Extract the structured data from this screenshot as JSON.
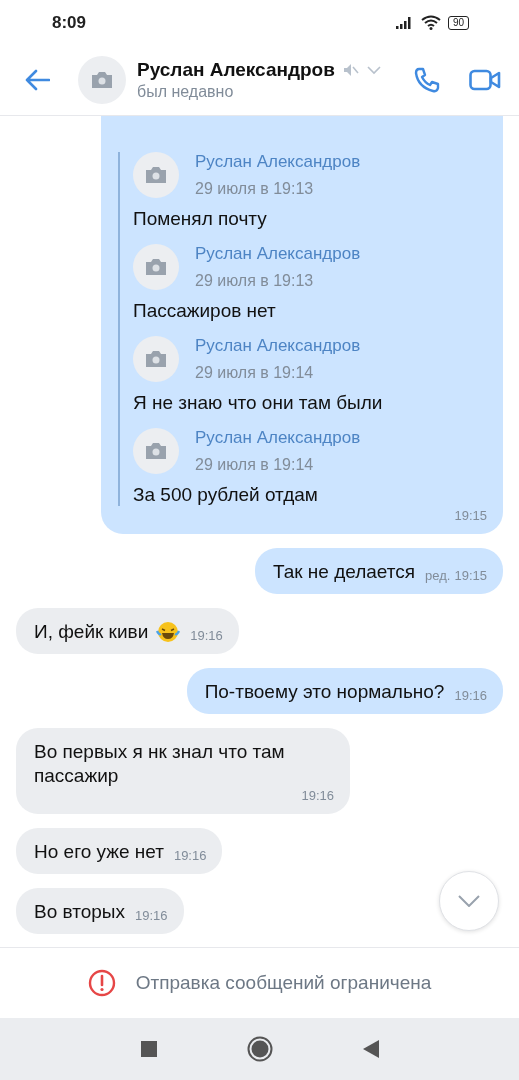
{
  "status_bar": {
    "time": "8:09",
    "battery": "90"
  },
  "header": {
    "contact_name": "Руслан Александров",
    "muted": true,
    "status": "был недавно"
  },
  "messages": [
    {
      "kind": "forwarded",
      "outgoing": true,
      "time": "19:15",
      "forwarded": [
        {
          "author": "Руслан Александров",
          "date": "29 июля в 19:13",
          "text": "Поменял почту"
        },
        {
          "author": "Руслан Александров",
          "date": "29 июля в 19:13",
          "text": "Пассажиров нет"
        },
        {
          "author": "Руслан Александров",
          "date": "29 июля в 19:14",
          "text": "Я не знаю что они там были"
        },
        {
          "author": "Руслан Александров",
          "date": "29 июля в 19:14",
          "text": "За 500 рублей отдам"
        }
      ]
    },
    {
      "kind": "text",
      "outgoing": true,
      "text": "Так не делается",
      "edited_label": "ред.",
      "time": "19:15"
    },
    {
      "kind": "text",
      "outgoing": false,
      "text": "И, фейк киви",
      "emoji": true,
      "time": "19:16"
    },
    {
      "kind": "text",
      "outgoing": true,
      "text": "По-твоему это нормально?",
      "time": "19:16"
    },
    {
      "kind": "text",
      "outgoing": false,
      "text": "Во первых я нк знал что там пассажир",
      "time": "19:16"
    },
    {
      "kind": "text",
      "outgoing": false,
      "text": "Но его уже нет",
      "time": "19:16"
    },
    {
      "kind": "text",
      "outgoing": false,
      "text": "Во вторых",
      "time": "19:16"
    }
  ],
  "notice": {
    "text": "Отправка сообщений ограничена"
  }
}
